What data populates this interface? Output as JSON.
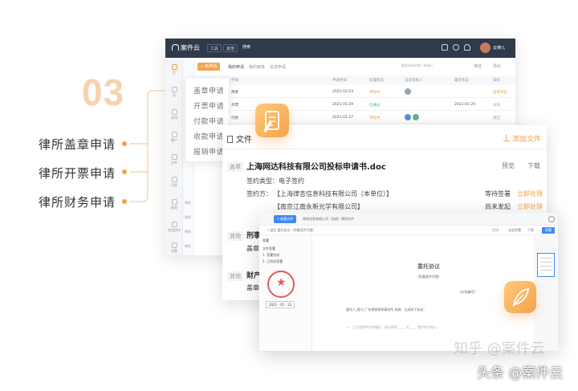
{
  "step": {
    "number": "03"
  },
  "features": [
    "律所盖章申请",
    "律所开票申请",
    "律所财务申请"
  ],
  "colors": {
    "accent": "#f0a04b",
    "step_number": "#f6d2ae",
    "topbar": "#2f3a4a",
    "primary_blue": "#3d8bf2",
    "seal_red": "#e15a5a"
  },
  "app": {
    "logo": "案件云",
    "topbar_selects": [
      "工具",
      "其他"
    ],
    "topbar_search": "搜索",
    "topbar_icons": [
      "grid-icon",
      "help-icon",
      "bell-icon"
    ],
    "user": "云律儿",
    "sidebar": [
      "案",
      "项",
      "合同",
      "客户",
      "文件",
      "日程",
      "报表",
      "在线协作",
      "设置"
    ],
    "subnav": [
      "审批",
      "我发",
      "审批",
      "审批",
      "审批"
    ],
    "new_button": "+ 新申请",
    "tabs": [
      "我的申请",
      "我的审批",
      "总览申请"
    ],
    "search_placeholder": "搜索申请名称 / 申请人",
    "actions": [
      "筛选",
      "导出"
    ],
    "table": {
      "headers": [
        "申请",
        "申请时间",
        "处理状态",
        "当前审批人",
        "最近状态",
        "操作"
      ],
      "rows": [
        {
          "name": "用章",
          "date": "2021-02-03",
          "status": "审批中",
          "latest": "",
          "op": "查看审批"
        },
        {
          "name": "开票",
          "date": "2021-01-29",
          "status": "已通过",
          "latest": "2021-01-29",
          "op": "详情"
        },
        {
          "name": "付款",
          "date": "2021-01-27",
          "status": "审批中",
          "latest": "",
          "op": "撤回"
        }
      ]
    }
  },
  "dropdown": {
    "items": [
      "盖章申请",
      "开票申请",
      "付款申请",
      "收款申请",
      "报销申请"
    ]
  },
  "file_panel": {
    "title": "文件",
    "add_button": "添加文件",
    "tags": [
      "盖章",
      "其他",
      "其他"
    ],
    "doc_title": "上海网达科技有限公司投标申请书.doc",
    "doc_actions": [
      "预览",
      "下载"
    ],
    "sign_type": "签约类型：电子签约",
    "signer_label": "签约方：",
    "signers": [
      {
        "name": "【上海律杏信息科技有限公司（本单位）】",
        "status": "等待签署",
        "action": "立即处理"
      },
      {
        "name": "【南京江南永新光学有限公司】",
        "status": "尚未发起",
        "action": "立即处理"
      }
    ],
    "sections": [
      {
        "heading": "刑事",
        "sub": "盖章"
      },
      {
        "heading": "财产",
        "sub": "盖章"
      }
    ]
  },
  "doc_window": {
    "new_button": "+ 新建文件",
    "breadcrumb": "律杏信息有限公司（总部）律所文件",
    "toolbar_left": "〈 返回   委托协议（刑事案件代理）",
    "tools": [
      "打印",
      "全部签署",
      "下载"
    ],
    "tool_primary": "签署",
    "left_panel": [
      "签署",
      "文件签署",
      "1. 签署完成",
      "2. 已完成签署"
    ],
    "seal_date": "2021 - 01 - 22",
    "paper_title": "委托协议",
    "paper_subtitle": "（刑事案件代理）",
    "paper_number": "[文档编号]",
    "paper_lines": [
      "委托人_姓与 广东律杏律师事务所 协商，达成如下协议：",
      "一、乙方接受甲方的委托，指派律师 ____ 为 ____ 案件的代理人。"
    ]
  },
  "watermark": {
    "zhihu": "知乎 @案件云",
    "brand": "头条 @案件云"
  }
}
